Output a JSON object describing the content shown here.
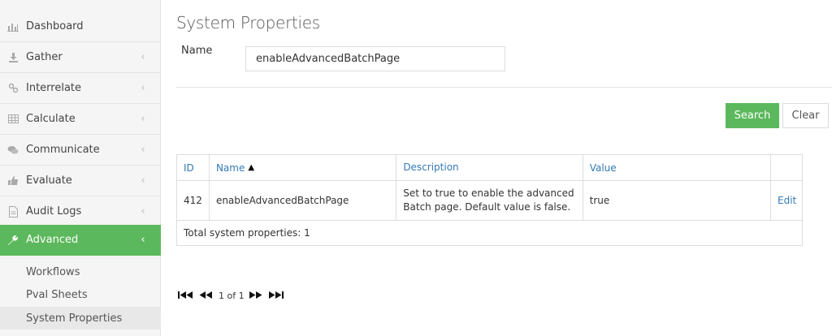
{
  "sidebar": {
    "items": [
      {
        "label": "Dashboard",
        "icon": "bar-chart-icon",
        "chevron": false
      },
      {
        "label": "Gather",
        "icon": "download-icon",
        "chevron": true
      },
      {
        "label": "Interrelate",
        "icon": "link-icon",
        "chevron": true
      },
      {
        "label": "Calculate",
        "icon": "table-icon",
        "chevron": true
      },
      {
        "label": "Communicate",
        "icon": "comments-icon",
        "chevron": true
      },
      {
        "label": "Evaluate",
        "icon": "thumbs-up-icon",
        "chevron": true
      },
      {
        "label": "Audit Logs",
        "icon": "document-icon",
        "chevron": true
      },
      {
        "label": "Advanced",
        "icon": "wrench-icon",
        "chevron": true,
        "active": true
      }
    ],
    "sub_items": [
      {
        "label": "Workflows"
      },
      {
        "label": "Pval Sheets"
      },
      {
        "label": "System Properties",
        "selected": true
      }
    ],
    "accent_color": "#5cb85c"
  },
  "main": {
    "title": "System Properties",
    "name_label": "Name",
    "name_value": "enableAdvancedBatchPage",
    "search_label": "Search",
    "clear_label": "Clear"
  },
  "table": {
    "headers": {
      "id": "ID",
      "name": "Name",
      "description": "Description",
      "value": "Value"
    },
    "sort_indicator": "▲",
    "rows": [
      {
        "id": "412",
        "name": "enableAdvancedBatchPage",
        "description_line1": "Set to true to enable the advanced",
        "description_line2": "Batch page. Default value is false.",
        "value": "true",
        "action": "Edit"
      }
    ],
    "footer": "Total system properties: 1"
  },
  "pagination": {
    "first": "⏮",
    "prev": "◀◀",
    "status": "1 of 1",
    "next": "▶▶",
    "last": "⏭"
  }
}
